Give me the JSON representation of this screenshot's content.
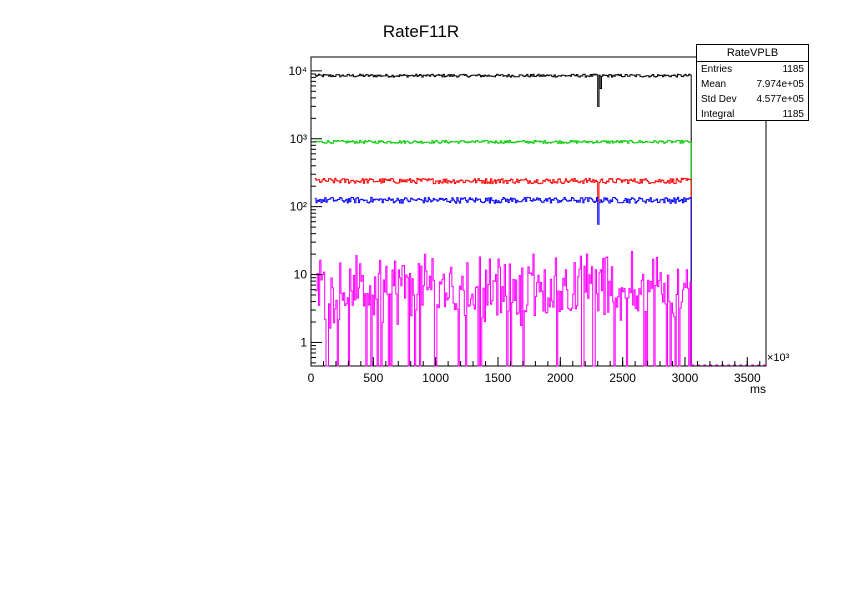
{
  "chart_data": {
    "type": "line",
    "title": "RateF11R",
    "xlabel": "ms",
    "x_multiplier_label": "×10³",
    "xlim": [
      0,
      3650
    ],
    "ylim": [
      0.45,
      16000
    ],
    "yscale": "log",
    "xticks": [
      0,
      500,
      1000,
      1500,
      2000,
      2500,
      3000,
      3500
    ],
    "xtick_labels": [
      "0",
      "500",
      "1000",
      "1500",
      "2000",
      "2500",
      "3000",
      "3500"
    ],
    "yticks": [
      1,
      10,
      100,
      1000,
      10000
    ],
    "ytick_labels": [
      "1",
      "10",
      "10²",
      "10³",
      "10⁴"
    ],
    "grid": false,
    "series": [
      {
        "color": "#000000",
        "base": 8500,
        "jitter": 0.05,
        "dips": [
          [
            2300,
            3000
          ],
          [
            2320,
            5500
          ]
        ]
      },
      {
        "color": "#00cc00",
        "base": 900,
        "jitter": 0.05,
        "dips": []
      },
      {
        "color": "#ff0000",
        "base": 240,
        "jitter": 0.09,
        "dips": [
          [
            2300,
            120
          ]
        ]
      },
      {
        "color": "#0000ff",
        "base": 125,
        "jitter": 0.1,
        "dips": [
          [
            2300,
            55
          ]
        ]
      },
      {
        "color": "#ff00ff",
        "base": 6,
        "jitter": 0.9,
        "dips": []
      }
    ],
    "x_start": 30,
    "x_end": 3050,
    "bin_width": 10
  },
  "stats": {
    "name": "RateVPLB",
    "rows": [
      {
        "label": "Entries",
        "value": "1185"
      },
      {
        "label": "Mean",
        "value": "7.974e+05"
      },
      {
        "label": "Std Dev",
        "value": "4.577e+05"
      },
      {
        "label": "Integral",
        "value": "1185"
      }
    ]
  }
}
